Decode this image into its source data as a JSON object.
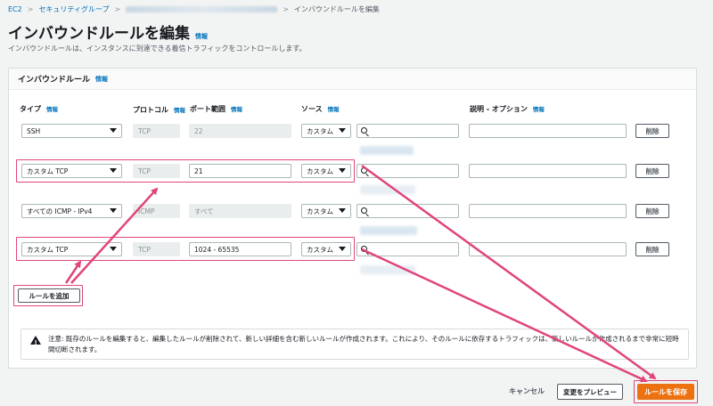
{
  "breadcrumb": {
    "root": "EC2",
    "security_groups": "セキュリティグループ",
    "current": "インバウンドルールを編集"
  },
  "page": {
    "title": "インバウンドルールを編集",
    "info": "情報",
    "description": "インバウンドルールは、インスタンスに到達できる着信トラフィックをコントロールします。"
  },
  "panel": {
    "title": "インバウンドルール",
    "info": "情報"
  },
  "columns": {
    "type": "タイプ",
    "protocol": "プロトコル",
    "port": "ポート範囲",
    "source": "ソース",
    "description": "説明 - オプション",
    "info": "情報"
  },
  "rules": [
    {
      "type": "SSH",
      "protocol": "TCP",
      "port": "22",
      "source": "カスタム",
      "delete": "削除"
    },
    {
      "type": "カスタム TCP",
      "protocol": "TCP",
      "port": "21",
      "source": "カスタム",
      "delete": "削除"
    },
    {
      "type": "すべての ICMP - IPv4",
      "protocol": "ICMP",
      "port": "すべて",
      "source": "カスタム",
      "delete": "削除"
    },
    {
      "type": "カスタム TCP",
      "protocol": "TCP",
      "port": "1024 - 65535",
      "source": "カスタム",
      "delete": "削除"
    }
  ],
  "add_rule": "ルールを追加",
  "warning": "注意: 既存のルールを編集すると、編集したルールが削除されて、新しい詳細を含む新しいルールが作成されます。これにより、そのルールに依存するトラフィックは、新しいルールが作成されるまで非常に短時間切断されます。",
  "footer": {
    "cancel": "キャンセル",
    "preview": "変更をプレビュー",
    "save": "ルールを保存"
  },
  "colors": {
    "accent": "#ec7211",
    "annotation": "#e0457b",
    "link": "#0073bb"
  }
}
